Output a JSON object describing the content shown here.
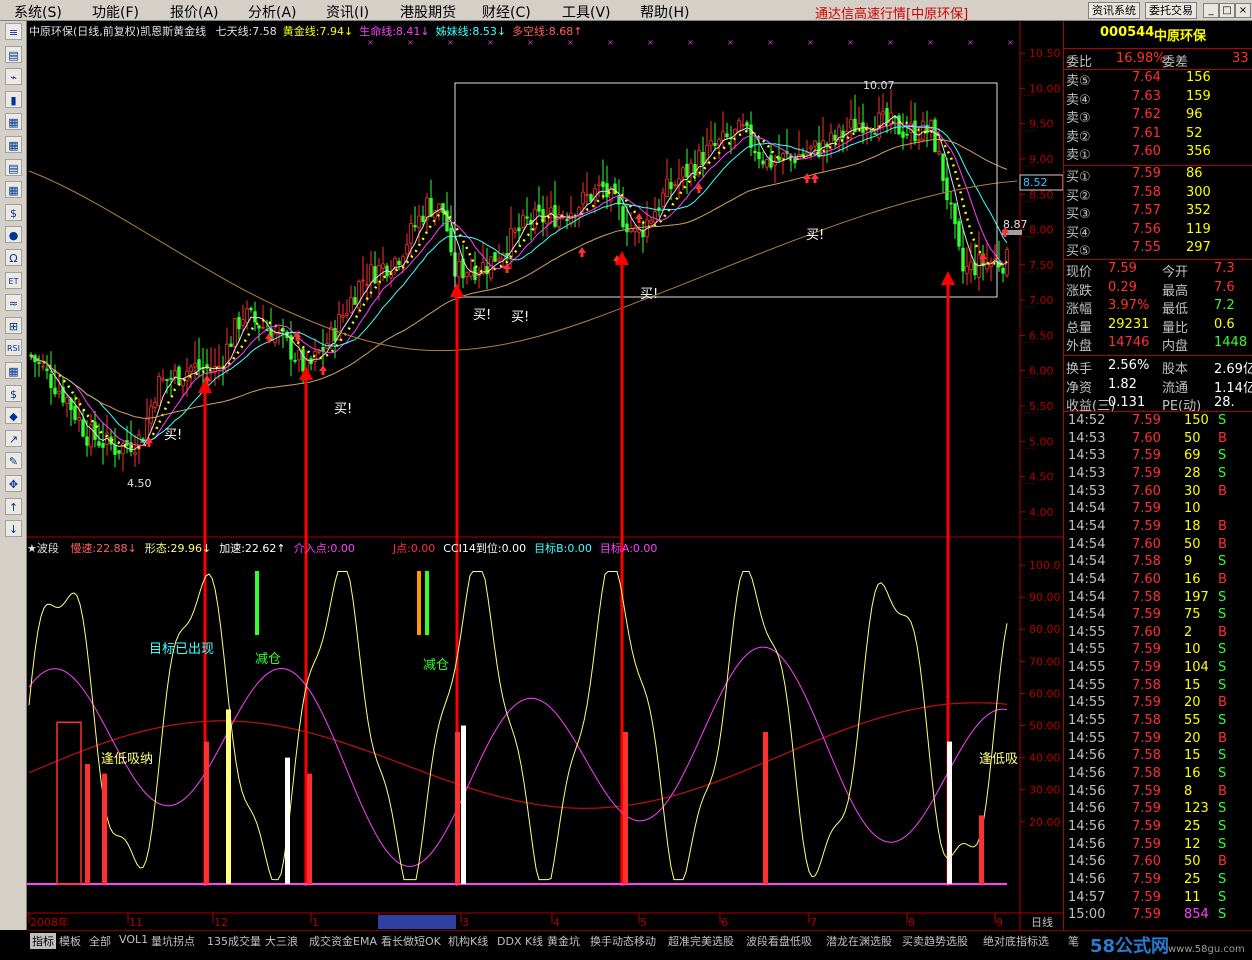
{
  "menu": [
    "系统(S)",
    "功能(F)",
    "报价(A)",
    "分析(A)",
    "资讯(I)",
    "港股期货",
    "财经(C)",
    "工具(V)",
    "帮助(H)"
  ],
  "app_title": "通达信高速行情[中原环保]",
  "buttons": {
    "info": "资讯系统",
    "trade": "委托交易"
  },
  "window_controls": [
    "_",
    "□",
    "×"
  ],
  "left_tools": [
    "≡",
    "▤",
    "⌁",
    "▮",
    "▦",
    "▦",
    "▤",
    "▦",
    "$",
    "●",
    "Ω",
    "ET",
    "≈",
    "⊞",
    "RSI",
    "▦",
    "$",
    "◆",
    "↗",
    "✎",
    "✥",
    "↑",
    "↓"
  ],
  "price_header": {
    "title": "中原环保(日线,前复权)凯恩斯黄金线",
    "items": [
      "七天线:7.58",
      "黄金线:7.94↓",
      "生命线:8.41↓",
      "姊妹线:8.53↓",
      "多空线:8.68↑"
    ],
    "colors": [
      "#e0e0e0",
      "#ffff00",
      "#ff40ff",
      "#40ffff",
      "#ff6060"
    ]
  },
  "osc_header": {
    "title": "★波段",
    "items": [
      "慢速:22.88↓",
      "形态:29.96↓",
      "加速:22.62↑",
      "介入点:0.00",
      "J点:0.00",
      "CCI14到位:0.00",
      "目标B:0.00",
      "目标A:0.00"
    ],
    "colors": [
      "#ff6060",
      "#ffff80",
      "#ffffff",
      "#ff40ff",
      "#ff3030",
      "#ffffff",
      "#40ffff",
      "#ff40ff"
    ]
  },
  "chart_data": [
    {
      "type": "candlestick",
      "title": "中原环保(日线,前复权)凯恩斯黄金线",
      "ylim": [
        3.7,
        10.7
      ],
      "yticks": [
        "10.50",
        "10.00",
        "9.50",
        "9.00",
        "8.50",
        "8.00",
        "7.50",
        "7.00",
        "6.50",
        "6.00",
        "5.50",
        "5.00",
        "4.50",
        "4.00"
      ],
      "annotations": [
        "4.50",
        "10.07",
        "8.87"
      ],
      "price_marker": "8.52",
      "signals": [
        "买!",
        "买!",
        "买!",
        "买!",
        "买!",
        "买!"
      ],
      "xticks": [
        "2008年",
        "11",
        "12",
        "1",
        "2009/02/03二",
        "3",
        "4",
        "5",
        "6",
        "7",
        "8",
        "9"
      ],
      "period_label": "日线"
    },
    {
      "type": "line",
      "title": "★波段",
      "ylim": [
        0,
        105
      ],
      "yticks": [
        "100.0",
        "90.00",
        "80.00",
        "70.00",
        "60.00",
        "50.00",
        "40.00",
        "30.00",
        "20.00"
      ],
      "annotations": [
        "逢低吸纳",
        "目标已出现",
        "减仓",
        "减仓",
        "逢低吸"
      ]
    }
  ],
  "quote": {
    "code": "000544",
    "name": "中原环保",
    "wb_label": "委比",
    "wb": "16.98%",
    "wc_label": "委差",
    "wc": "33",
    "asks": [
      {
        "label": "卖⑤",
        "price": "7.64",
        "vol": "156"
      },
      {
        "label": "卖④",
        "price": "7.63",
        "vol": "159"
      },
      {
        "label": "卖③",
        "price": "7.62",
        "vol": "96"
      },
      {
        "label": "卖②",
        "price": "7.61",
        "vol": "52"
      },
      {
        "label": "卖①",
        "price": "7.60",
        "vol": "356"
      }
    ],
    "bids": [
      {
        "label": "买①",
        "price": "7.59",
        "vol": "86"
      },
      {
        "label": "买②",
        "price": "7.58",
        "vol": "300"
      },
      {
        "label": "买③",
        "price": "7.57",
        "vol": "352"
      },
      {
        "label": "买④",
        "price": "7.56",
        "vol": "119"
      },
      {
        "label": "买⑤",
        "price": "7.55",
        "vol": "297"
      }
    ],
    "stats": [
      [
        "现价",
        "7.59",
        "今开",
        "7.3"
      ],
      [
        "涨跌",
        "0.29",
        "最高",
        "7.6"
      ],
      [
        "涨幅",
        "3.97%",
        "最低",
        "7.2"
      ],
      [
        "总量",
        "29231",
        "量比",
        "0.6"
      ],
      [
        "外盘",
        "14746",
        "内盘",
        "1448"
      ],
      [
        "换手",
        "2.56%",
        "股本",
        "2.69亿"
      ],
      [
        "净资",
        "1.82",
        "流通",
        "1.14亿"
      ],
      [
        "收益(三)",
        "0.131",
        "PE(动)",
        "28."
      ]
    ],
    "ticks": [
      [
        "14:52",
        "7.59",
        "150",
        "S"
      ],
      [
        "14:53",
        "7.60",
        "50",
        "B"
      ],
      [
        "14:53",
        "7.59",
        "69",
        "S"
      ],
      [
        "14:53",
        "7.59",
        "28",
        "S"
      ],
      [
        "14:53",
        "7.60",
        "30",
        "B"
      ],
      [
        "14:54",
        "7.59",
        "10",
        ""
      ],
      [
        "14:54",
        "7.59",
        "18",
        "B"
      ],
      [
        "14:54",
        "7.60",
        "50",
        "B"
      ],
      [
        "14:54",
        "7.58",
        "9",
        "S"
      ],
      [
        "14:54",
        "7.60",
        "16",
        "B"
      ],
      [
        "14:54",
        "7.58",
        "197",
        "S"
      ],
      [
        "14:54",
        "7.59",
        "75",
        "S"
      ],
      [
        "14:55",
        "7.60",
        "2",
        "B"
      ],
      [
        "14:55",
        "7.59",
        "10",
        "S"
      ],
      [
        "14:55",
        "7.59",
        "104",
        "S"
      ],
      [
        "14:55",
        "7.58",
        "15",
        "S"
      ],
      [
        "14:55",
        "7.59",
        "20",
        "B"
      ],
      [
        "14:55",
        "7.58",
        "55",
        "S"
      ],
      [
        "14:55",
        "7.59",
        "20",
        "B"
      ],
      [
        "14:56",
        "7.58",
        "15",
        "S"
      ],
      [
        "14:56",
        "7.58",
        "16",
        "S"
      ],
      [
        "14:56",
        "7.59",
        "8",
        "B"
      ],
      [
        "14:56",
        "7.59",
        "123",
        "S"
      ],
      [
        "14:56",
        "7.59",
        "25",
        "S"
      ],
      [
        "14:56",
        "7.59",
        "12",
        "S"
      ],
      [
        "14:56",
        "7.60",
        "50",
        "B"
      ],
      [
        "14:56",
        "7.59",
        "25",
        "S"
      ],
      [
        "14:57",
        "7.59",
        "11",
        "S"
      ],
      [
        "15:00",
        "7.59",
        "854",
        "S"
      ]
    ]
  },
  "bottom_tabs": [
    "指标",
    "模板",
    "全部",
    "VOL1",
    "量坑拐点",
    "135成交量",
    "大三浪",
    "成交资金EMA",
    "看长做短OK",
    "机构K线",
    "DDX K线",
    "黄金坑",
    "换手动态移动",
    "超准完美选股",
    "波段看盘低吸",
    "潜龙在渊选股",
    "买卖趋势选股",
    "绝对底指标选",
    "笔"
  ],
  "watermark": "58公式网",
  "watermark_url": "www.58gu.com"
}
